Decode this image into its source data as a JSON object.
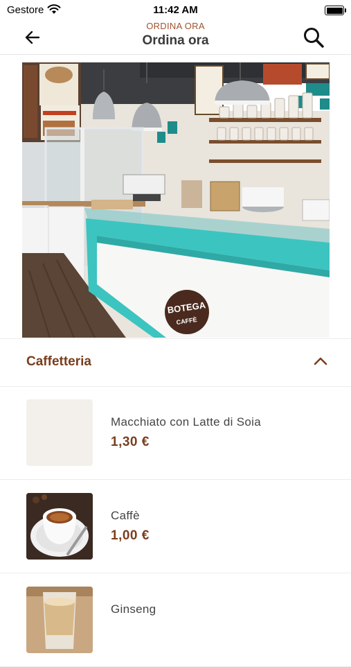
{
  "status_bar": {
    "carrier": "Gestore",
    "time": "11:42 AM",
    "battery_level": 1.0
  },
  "nav": {
    "eyebrow": "ORDINA ORA",
    "title": "Ordina ora",
    "icons": [
      "arrow-left-icon",
      "search-icon"
    ]
  },
  "hero": {
    "sign_line1": "BOTEGA",
    "sign_line2": "CAFFÈ"
  },
  "section": {
    "title": "Caffetteria",
    "expanded": true
  },
  "products": [
    {
      "name": "Macchiato con Latte di Soia",
      "price": "1,30 €",
      "image": "placeholder"
    },
    {
      "name": "Caffè",
      "price": "1,00 €",
      "image": "espresso-cup"
    },
    {
      "name": "Ginseng",
      "price": "",
      "image": "ginseng-glass"
    }
  ],
  "colors": {
    "accent": "#7a3e1d",
    "eyebrow": "#a0522d",
    "counter": "#3cc4c0"
  }
}
